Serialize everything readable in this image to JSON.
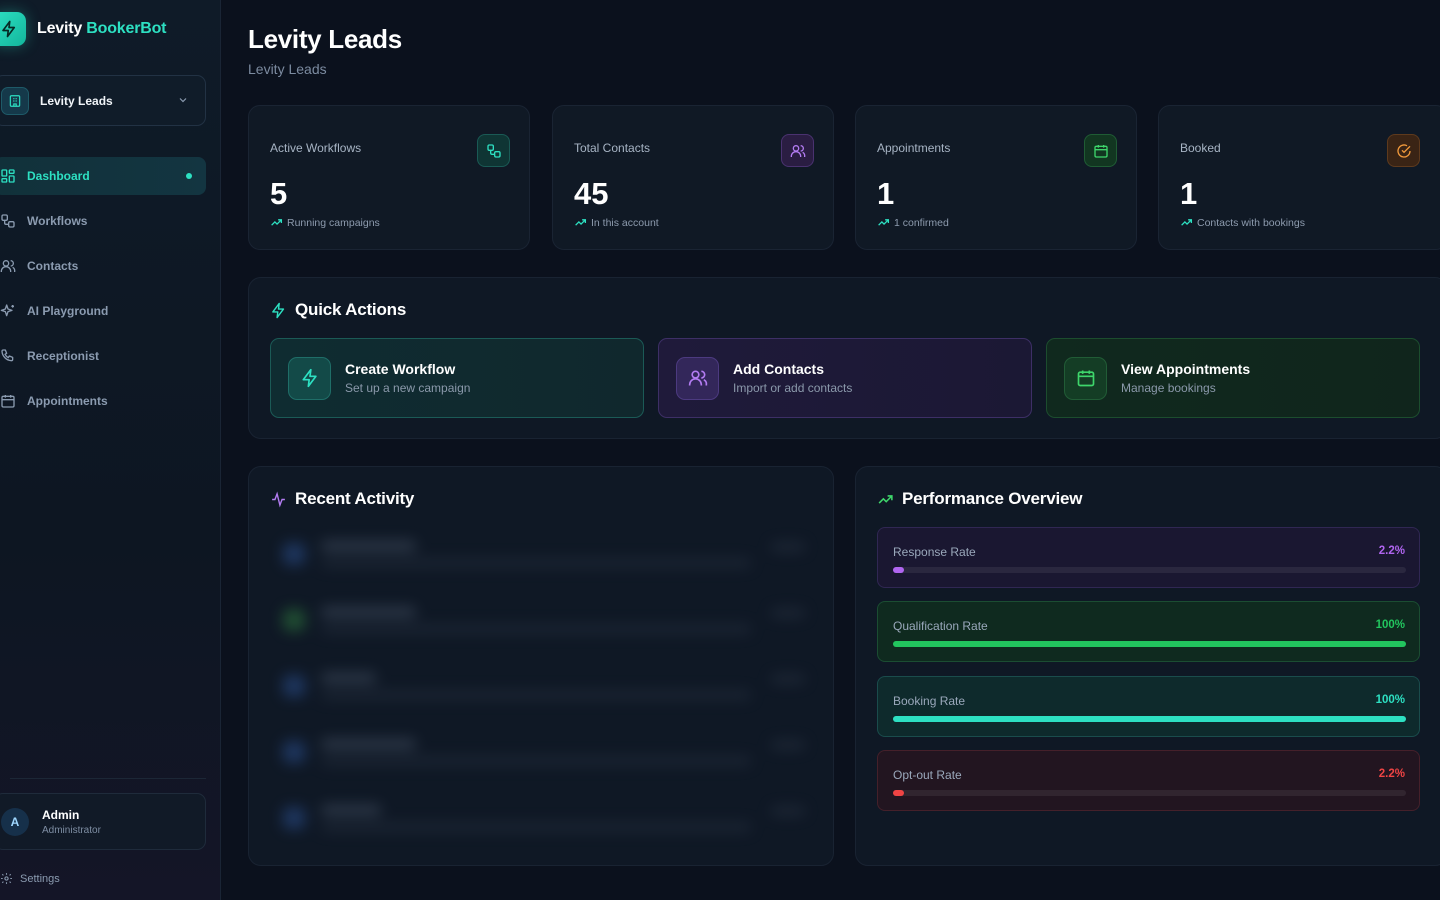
{
  "brand": {
    "name_part1": "Levity",
    "name_part2": "BookerBot"
  },
  "account_selector": {
    "label": "Levity Leads"
  },
  "sidebar": {
    "items": [
      {
        "label": "Dashboard",
        "icon": "dashboard-icon",
        "active": true
      },
      {
        "label": "Workflows",
        "icon": "workflow-icon"
      },
      {
        "label": "Contacts",
        "icon": "contacts-icon"
      },
      {
        "label": "AI Playground",
        "icon": "sparkles-icon"
      },
      {
        "label": "Receptionist",
        "icon": "phone-icon"
      },
      {
        "label": "Appointments",
        "icon": "calendar-icon"
      }
    ],
    "user": {
      "initial": "A",
      "name": "Admin",
      "role": "Administrator"
    },
    "settings_label": "Settings"
  },
  "header": {
    "title": "Levity Leads",
    "subtitle": "Levity Leads"
  },
  "stats": [
    {
      "label": "Active Workflows",
      "value": "5",
      "note": "Running campaigns",
      "icon": "workflow-icon",
      "color": "#2de0c2"
    },
    {
      "label": "Total Contacts",
      "value": "45",
      "note": "In this account",
      "icon": "users-icon",
      "color": "#b37cf2"
    },
    {
      "label": "Appointments",
      "value": "1",
      "note": "1 confirmed",
      "icon": "calendar-icon",
      "color": "#3ed66b"
    },
    {
      "label": "Booked",
      "value": "1",
      "note": "Contacts with bookings",
      "icon": "check-circle-icon",
      "color": "#f29a3c"
    }
  ],
  "quick_actions": {
    "title": "Quick Actions",
    "items": [
      {
        "title": "Create Workflow",
        "subtitle": "Set up a new campaign",
        "icon": "lightning-icon",
        "color": "#2de0c2"
      },
      {
        "title": "Add Contacts",
        "subtitle": "Import or add contacts",
        "icon": "users-icon",
        "color": "#b37cf2"
      },
      {
        "title": "View Appointments",
        "subtitle": "Manage bookings",
        "icon": "calendar-icon",
        "color": "#3ed66b"
      }
    ]
  },
  "recent_activity": {
    "title": "Recent Activity"
  },
  "performance": {
    "title": "Performance Overview",
    "metrics": [
      {
        "label": "Response Rate",
        "value": "2.2%",
        "percent": 2.2,
        "color": "#b065f0"
      },
      {
        "label": "Qualification Rate",
        "value": "100%",
        "percent": 100,
        "color": "#22c55e"
      },
      {
        "label": "Booking Rate",
        "value": "100%",
        "percent": 100,
        "color": "#2de0c2"
      },
      {
        "label": "Opt-out Rate",
        "value": "2.2%",
        "percent": 2.2,
        "color": "#ef4444"
      }
    ]
  },
  "colors": {
    "accent": "#2de0c2",
    "background": "#0b111d",
    "purple": "#b37cf2",
    "green": "#3ed66b",
    "orange": "#f29a3c",
    "red": "#ef4444"
  }
}
